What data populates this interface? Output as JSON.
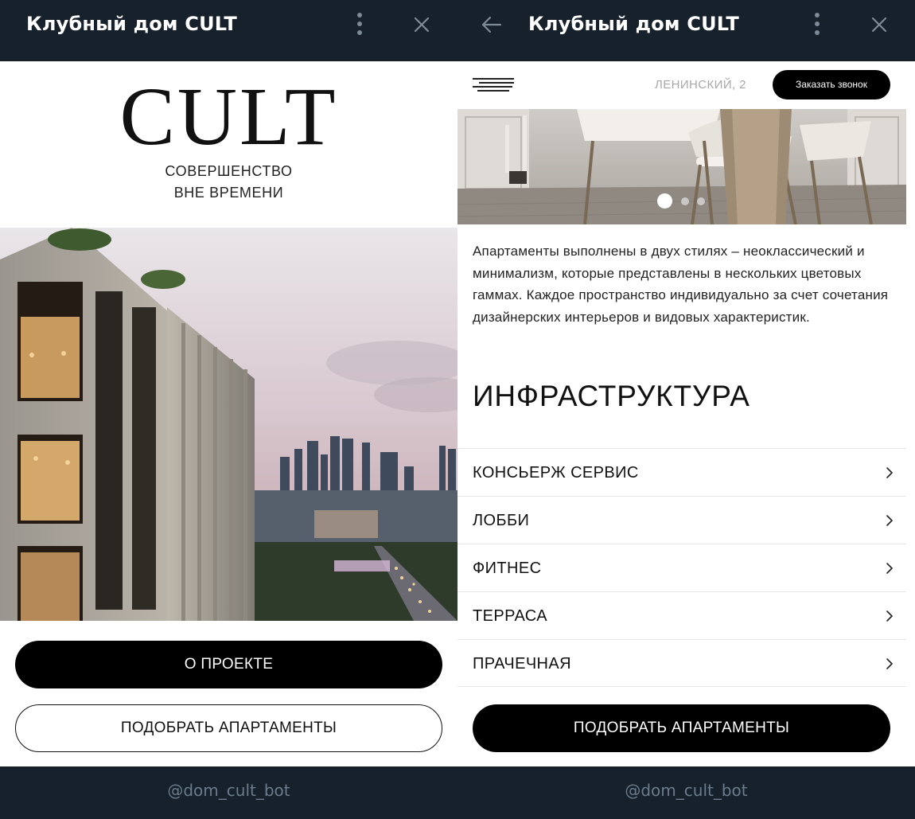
{
  "left": {
    "header": {
      "title": "Клубный дом CULT",
      "menu_icon": "more-vertical-icon",
      "close_icon": "close-icon"
    },
    "logo_text": "CULT",
    "tagline": [
      "СОВЕРШЕНСТВО",
      "ВНЕ ВРЕМЕНИ"
    ],
    "hero_image": "city-building-render",
    "buttons": {
      "about": "О ПРОЕКТЕ",
      "choose": "ПОДОБРАТЬ АПАРТАМЕНТЫ"
    },
    "footer": {
      "bot": "@dom_cult_bot"
    }
  },
  "right": {
    "header": {
      "title": "Клубный дом CULT",
      "back_icon": "arrow-left-icon",
      "menu_icon": "more-vertical-icon",
      "close_icon": "close-icon"
    },
    "topbar": {
      "menu_icon": "hamburger-icon",
      "address": "ЛЕНИНСКИЙ, 2",
      "call_button": "Заказать звонок"
    },
    "slider": {
      "image": "interior-dining-chairs",
      "slides": 3,
      "active": 1
    },
    "description": "Апартаменты выполнены в двух стилях – неоклассический и минимализм, которые представлены в нескольких цветовых гаммах. Каждое пространство индивидуально за счет сочетания дизайнерских интерьеров и видовых характеристик.",
    "section_title": "ИНФРАСТРУКТУРА",
    "infrastructure": [
      {
        "label": "КОНСЬЕРЖ СЕРВИС"
      },
      {
        "label": "ЛОББИ"
      },
      {
        "label": "ФИТНЕС"
      },
      {
        "label": "ТЕРРАСА"
      },
      {
        "label": "ПРАЧЕЧНАЯ"
      }
    ],
    "buttons": {
      "choose": "ПОДОБРАТЬ АПАРТАМЕНТЫ"
    },
    "footer": {
      "bot": "@dom_cult_bot"
    }
  },
  "colors": {
    "telegram_bg": "#17212b",
    "accent": "#000000",
    "muted": "#a7a7a7",
    "footer_text": "#6b7b8c"
  }
}
